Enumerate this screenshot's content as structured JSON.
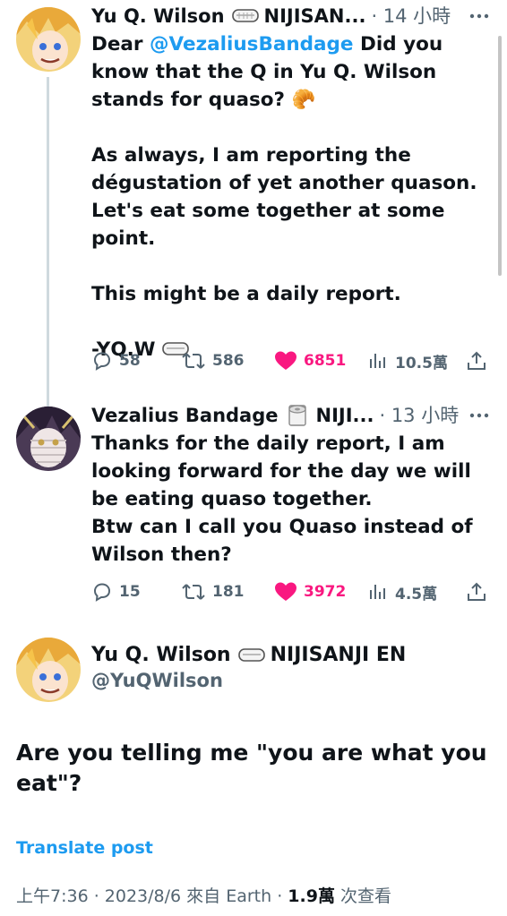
{
  "tweets": [
    {
      "name": "Yu Q. Wilson",
      "name_suffix": "NIJISAN...",
      "time": "· 14 小時",
      "text_mention": "@VezaliusBandage",
      "text_before": "Dear ",
      "text_after": " Did you know that the Q in Yu Q. Wilson stands for quaso? 🥐\n\nAs always, I am reporting the dégustation of yet another quason.\nLet's eat some together at some point.\n\nThis might be a daily report.\n\n-YQ.W ",
      "replies": "58",
      "retweets": "586",
      "likes": "6851",
      "views": "10.5萬"
    },
    {
      "name": "Vezalius Bandage",
      "name_suffix": "NIJI...",
      "time": "· 13 小時",
      "text": "Thanks for the daily report, I am looking forward for the day we will be eating quaso together.\nBtw can I call you Quaso instead of Wilson then?",
      "replies": "15",
      "retweets": "181",
      "likes": "3972",
      "views": "4.5萬"
    }
  ],
  "main_tweet": {
    "name": "Yu Q. Wilson",
    "name_suffix": "NIJISANJI EN",
    "handle": "@YuQWilson",
    "text": "Are you telling me \"you are what you eat\"?",
    "translate_label": "Translate post",
    "meta_time": "上午7:36 · 2023/8/6 來自 Earth · ",
    "meta_views": "1.9萬",
    "meta_views_label": " 次查看"
  },
  "colors": {
    "accent": "#1d9bf0",
    "like": "#f91880",
    "muted": "#536471",
    "text": "#0f1419"
  }
}
